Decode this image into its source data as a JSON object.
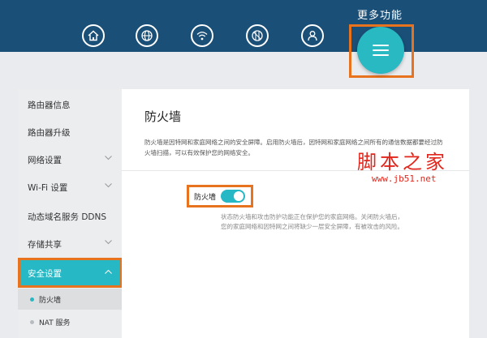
{
  "header": {
    "more_label": "更多功能",
    "nav_icons": [
      "home-icon",
      "globe-icon",
      "wifi-icon",
      "globe-alt-icon",
      "user-icon"
    ],
    "more_icon": "menu-icon"
  },
  "sidebar": {
    "items": [
      {
        "label": "路由器信息"
      },
      {
        "label": "路由器升级"
      },
      {
        "label": "网络设置"
      },
      {
        "label": "Wi-Fi 设置"
      },
      {
        "label": "动态域名服务 DDNS"
      },
      {
        "label": "存储共享"
      },
      {
        "label": "安全设置"
      }
    ],
    "sub_items": [
      {
        "label": "防火墙"
      },
      {
        "label": "NAT 服务"
      }
    ]
  },
  "main": {
    "title": "防火墙",
    "description": "防火墙是因特网和家庭网络之间的安全屏障。启用防火墙后，因特网和家庭网络之间所有的通信数据都要经过防火墙扫描，可以有效保护您的网络安全。",
    "toggle_label": "防火墙",
    "toggle_state": "on",
    "status_text": "状态防火墙和攻击防护功能正在保护您的家庭网络。关闭防火墙后，您的家庭网络和因特网之间将缺少一层安全屏障，有被攻击的风险。"
  },
  "watermark": {
    "text_cn": "脚本之家",
    "url": "www.jb51.net"
  },
  "colors": {
    "header": "#1a4f77",
    "accent": "#26b8c4",
    "highlight": "#e8731f",
    "watermark": "#e1261c"
  }
}
